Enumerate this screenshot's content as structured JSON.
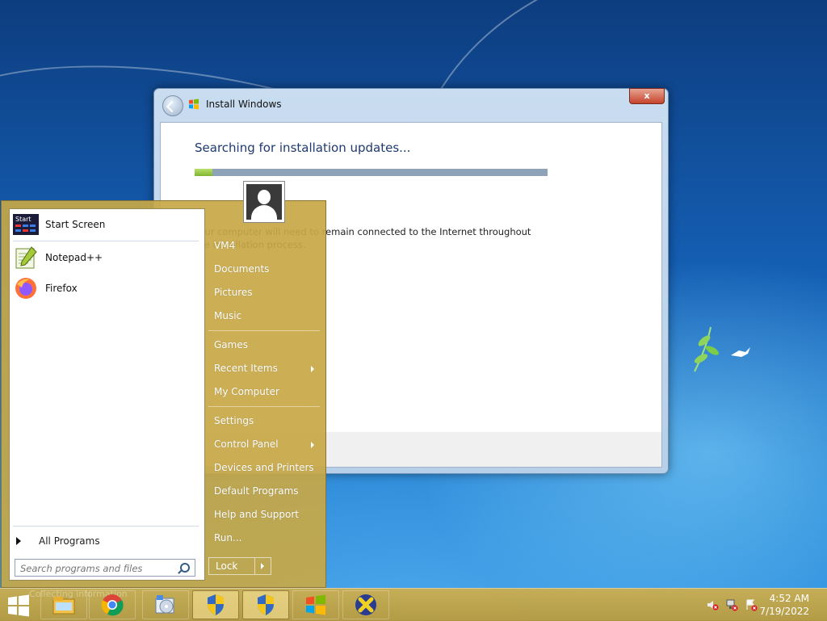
{
  "installer": {
    "title": "Install Windows",
    "close_label": "x",
    "heading": "Searching for installation updates...",
    "progress_percent": 5,
    "info_text": "Your computer will need to remain connected to the Internet throughout the installation process."
  },
  "start_menu": {
    "pinned": [
      {
        "label": "Start Screen",
        "icon": "start-screen-icon"
      },
      {
        "label": "Notepad++",
        "icon": "notepad-plus-plus-icon"
      },
      {
        "label": "Firefox",
        "icon": "firefox-icon"
      }
    ],
    "all_programs": "All Programs",
    "search_placeholder": "Search programs and files",
    "right_items": [
      {
        "label": "VM4",
        "arrow": false
      },
      {
        "label": "Documents",
        "arrow": false
      },
      {
        "label": "Pictures",
        "arrow": false
      },
      {
        "label": "Music",
        "arrow": false
      },
      {
        "label": "Games",
        "arrow": false
      },
      {
        "label": "Recent Items",
        "arrow": true
      },
      {
        "label": "My Computer",
        "arrow": false
      },
      {
        "label": "Settings",
        "arrow": false
      },
      {
        "label": "Control Panel",
        "arrow": true
      },
      {
        "label": "Devices and Printers",
        "arrow": false
      },
      {
        "label": "Default Programs",
        "arrow": false
      },
      {
        "label": "Help and Support",
        "arrow": false
      },
      {
        "label": "Run...",
        "arrow": false
      }
    ],
    "lock_label": "Lock"
  },
  "taskbar": {
    "ghost_text": "Collecting information",
    "items": [
      "file-explorer-icon",
      "chrome-icon",
      "media-setup-icon",
      "uac-shield-icon",
      "uac-shield-icon",
      "windows-setup-icon",
      "x-app-icon"
    ],
    "tray": [
      "volume-muted-icon",
      "network-disconnected-icon",
      "action-center-icon"
    ],
    "time": "4:52 AM",
    "date": "7/19/2022"
  },
  "colors": {
    "start_menu_bg": "#c8a846",
    "heading": "#1e3a6e",
    "progress": "#7fb52e"
  }
}
